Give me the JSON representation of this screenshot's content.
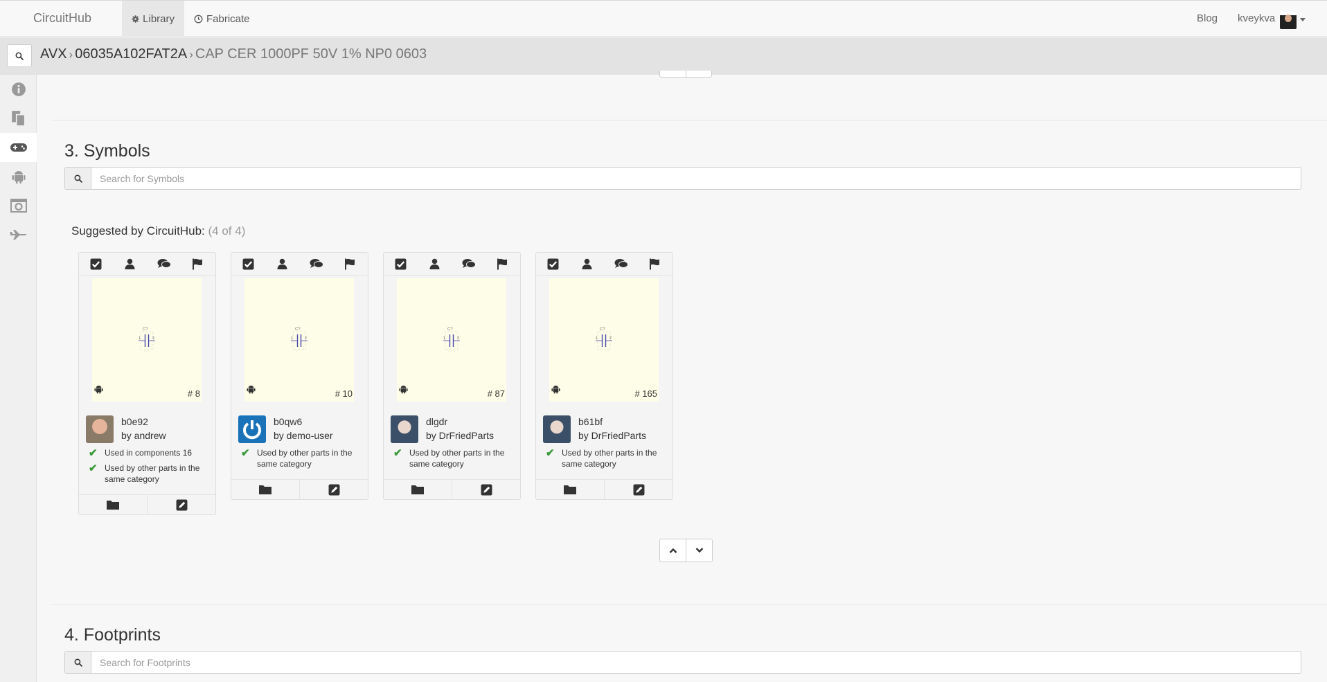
{
  "app": {
    "brand": "CircuitHub"
  },
  "nav": {
    "library": "Library",
    "fabricate": "Fabricate",
    "blog": "Blog",
    "user": "kveykva"
  },
  "breadcrumb": {
    "manufacturer": "AVX",
    "part_number": "06035A102FAT2A",
    "description": "CAP CER 1000PF 50V 1% NP0 0603"
  },
  "sidebar": {
    "icons": [
      "info-icon",
      "copy-icon",
      "gamepad-icon",
      "android-icon",
      "camera-icon",
      "plane-icon"
    ],
    "active_index": 2
  },
  "symbols": {
    "title": "3. Symbols",
    "search_placeholder": "Search for Symbols",
    "suggested_label": "Suggested by CircuitHub:",
    "suggested_count": "(4 of 4)",
    "cards": [
      {
        "rank": "# 8",
        "code": "b0e92",
        "author": "by andrew",
        "checks": [
          "Used in components 16",
          "Used by other parts in the same category"
        ]
      },
      {
        "rank": "# 10",
        "code": "b0qw6",
        "author": "by demo-user",
        "checks": [
          "Used by other parts in the same category"
        ]
      },
      {
        "rank": "# 87",
        "code": "dlgdr",
        "author": "by DrFriedParts",
        "checks": [
          "Used by other parts in the same category"
        ]
      },
      {
        "rank": "# 165",
        "code": "b61bf",
        "author": "by DrFriedParts",
        "checks": [
          "Used by other parts in the same category"
        ]
      }
    ]
  },
  "footprints": {
    "title": "4. Footprints",
    "search_placeholder": "Search for Footprints"
  },
  "colors": {
    "check_green": "#3a9a3a",
    "preview_bg": "#fefee8",
    "demo_avatar_blue": "#1a73b8"
  }
}
